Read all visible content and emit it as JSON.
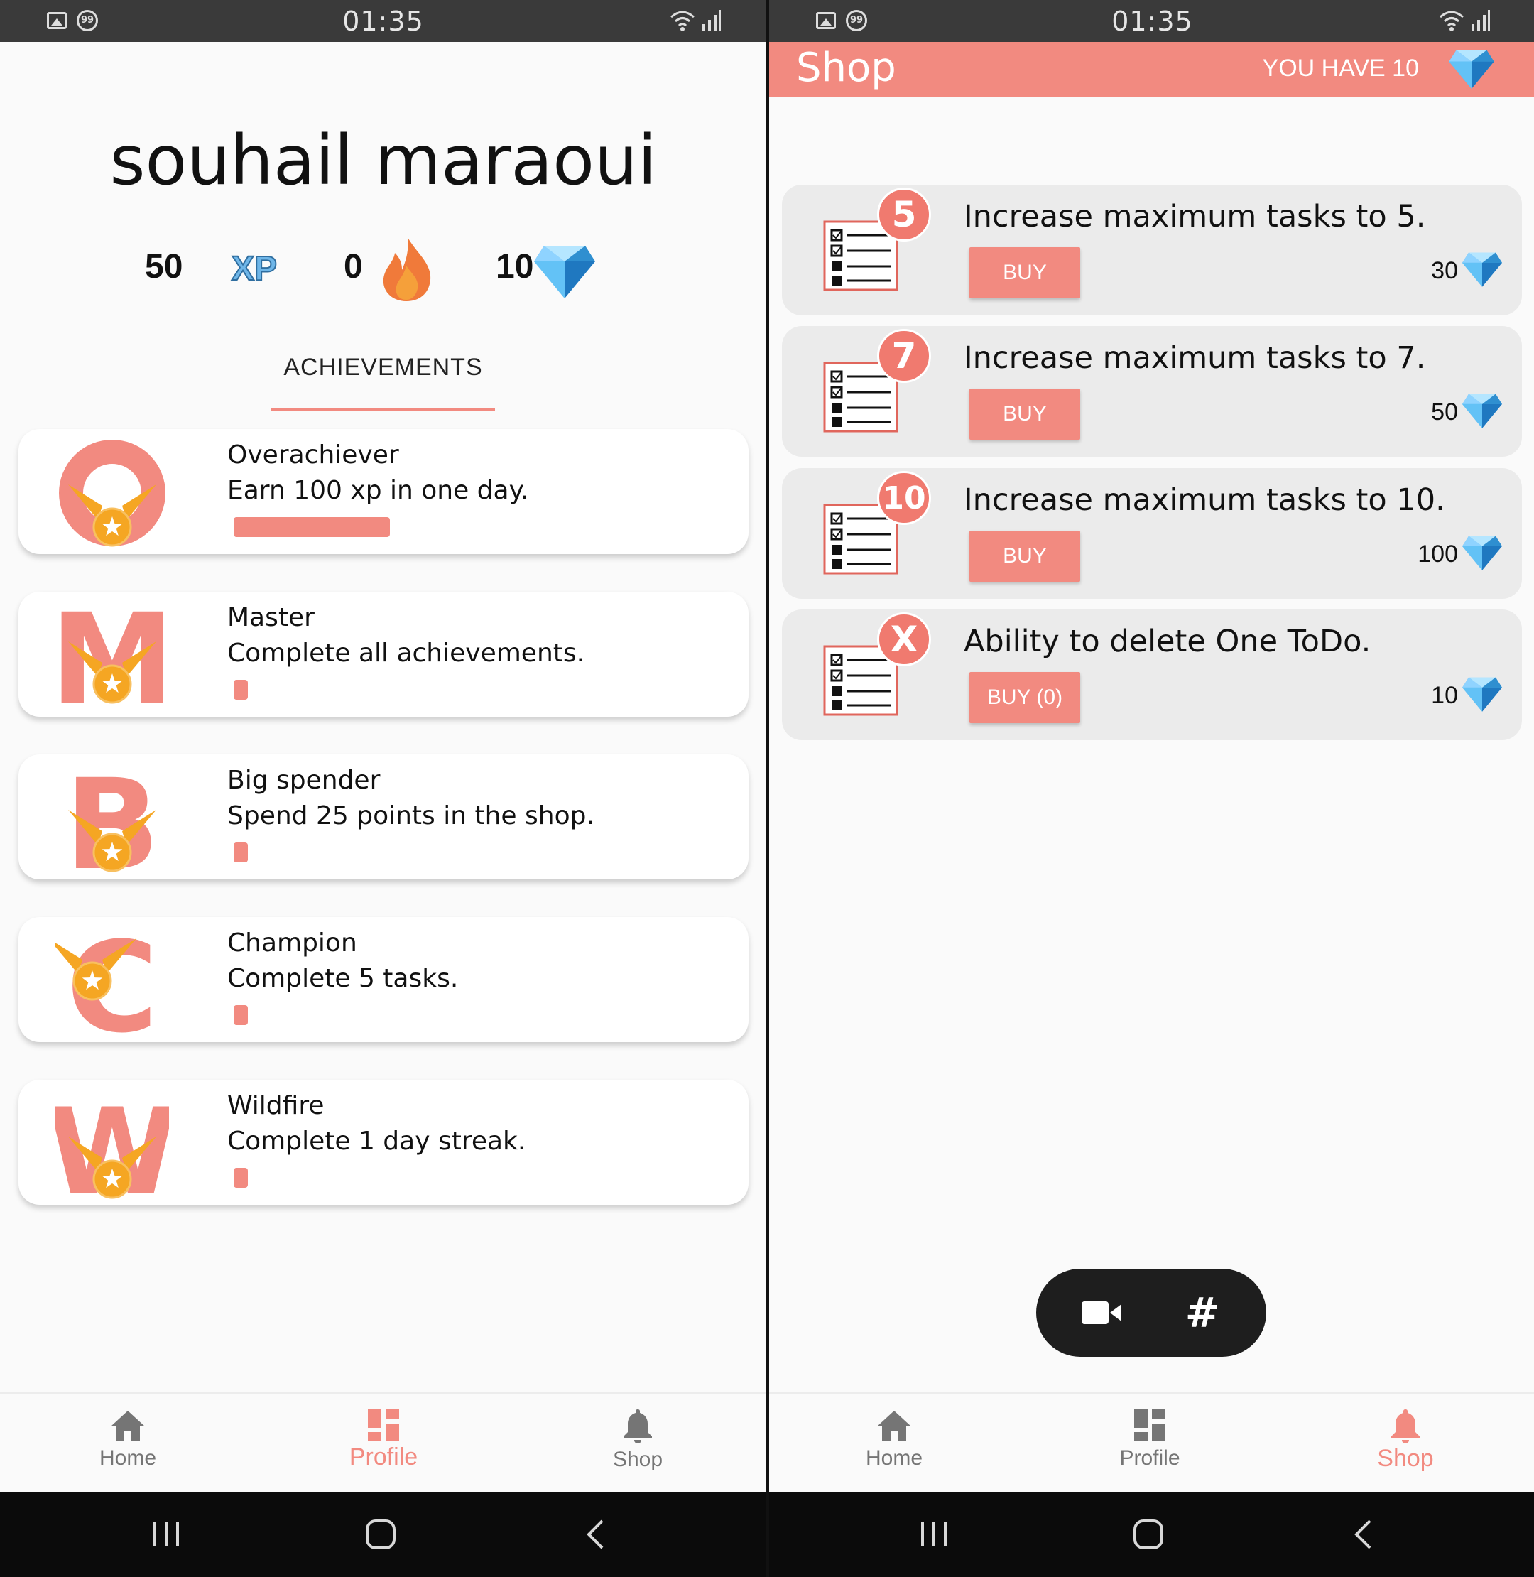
{
  "status_bar": {
    "time": "01:35"
  },
  "profile": {
    "name": "souhail maraoui",
    "xp_value": "50",
    "xp_label": "XP",
    "streak_value": "0",
    "gems_value": "10",
    "tab_label": "ACHIEVEMENTS",
    "achievements": [
      {
        "title": "Overachiever",
        "description": "Earn 100 xp in one day.",
        "letter": "O",
        "progress_fraction": 0.5
      },
      {
        "title": "Master",
        "description": "Complete all achievements.",
        "letter": "M",
        "progress_fraction": 0.0
      },
      {
        "title": "Big spender",
        "description": "Spend 25 points in the shop.",
        "letter": "B",
        "progress_fraction": 0.0
      },
      {
        "title": "Champion",
        "description": "Complete 5 tasks.",
        "letter": "C",
        "progress_fraction": 0.0
      },
      {
        "title": "Wildfire",
        "description": "Complete 1 day streak.",
        "letter": "W",
        "progress_fraction": 0.0
      }
    ]
  },
  "shop": {
    "title": "Shop",
    "balance_label": "YOU HAVE 10",
    "items": [
      {
        "badge": "5",
        "title": "Increase maximum tasks to 5.",
        "button": "BUY",
        "price": "30"
      },
      {
        "badge": "7",
        "title": "Increase maximum tasks to 7.",
        "button": "BUY",
        "price": "50"
      },
      {
        "badge": "10",
        "title": "Increase maximum tasks to 10.",
        "button": "BUY",
        "price": "100"
      },
      {
        "badge": "X",
        "title": "Ability to delete One ToDo.",
        "button": "BUY (0)",
        "price": "10"
      }
    ],
    "fab": {
      "video_icon": "video-camera-icon",
      "hash_label": "#"
    }
  },
  "bottom_nav": {
    "home": "Home",
    "profile": "Profile",
    "shop": "Shop"
  },
  "colors": {
    "accent": "#f28a80",
    "gold": "#f5a623",
    "gem": "#4fb3f0",
    "status_bar": "#3a3a3a"
  }
}
